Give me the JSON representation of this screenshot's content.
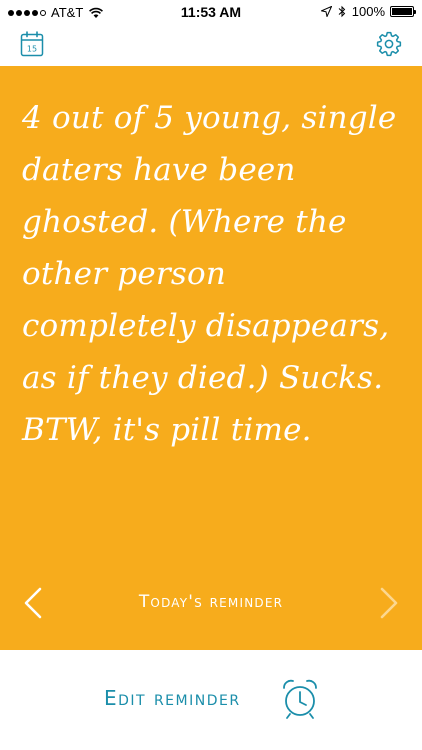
{
  "status_bar": {
    "carrier": "AT&T",
    "time": "11:53 AM",
    "battery": "100%",
    "battery_level": 1.0,
    "signal_bars_filled": 4,
    "signal_bars_total": 5
  },
  "nav": {
    "calendar_day": "15",
    "calendar_icon": "calendar-icon",
    "settings_icon": "gear-icon"
  },
  "card": {
    "message": "4 out of 5 young, single daters have been ghosted. (Where the other person completely disappears, as if they died.) Sucks. BTW, it's pill time.",
    "label": "Today's reminder",
    "prev_icon": "chevron-left-icon",
    "next_icon": "chevron-right-icon"
  },
  "bottom": {
    "edit_label": "Edit reminder",
    "alarm_icon": "alarm-clock-icon"
  },
  "colors": {
    "card_background": "#f7ac1c",
    "accent": "#1b8eaa",
    "card_text": "#ffffff",
    "disabled_arrow": "#fcd78f"
  }
}
